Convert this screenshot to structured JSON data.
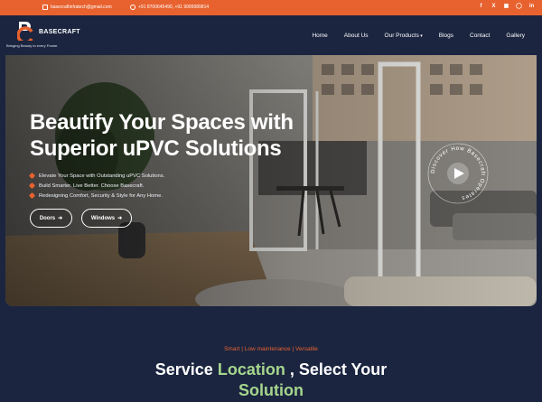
{
  "topbar": {
    "email": "basecraftinfratech@gmail.com",
    "phone": "+91 8700645490, +91 9999989814",
    "social_icons": [
      "facebook-icon",
      "x-icon",
      "instagram-icon",
      "whatsapp-icon",
      "linkedin-icon"
    ]
  },
  "brand": {
    "name": "BASECRAFT",
    "tagline": "Bringing Beauty to every Frame."
  },
  "nav": {
    "items": [
      "Home",
      "About Us",
      "Our Products",
      "Blogs",
      "Contact",
      "Gallery"
    ]
  },
  "hero": {
    "title_line1": "Beautify Your Spaces with",
    "title_line2": "Superior uPVC Solutions",
    "bullets": [
      "Elevate Your Space with Outstanding uPVC Solutions.",
      "Build Smarter. Live Better. Choose Basecraft.",
      "Redesigning Comfort, Security & Style for Any Home."
    ],
    "btn_doors": "Doors",
    "btn_windows": "Windows",
    "badge_text": "Discover How Basecraft Operates"
  },
  "section": {
    "kicker": "Smart | Low maintenance | Versatile",
    "title_a": "Service ",
    "title_b": "Location",
    "title_c": " , Select Your",
    "title_d": "Solution"
  },
  "colors": {
    "accent": "#e8622f",
    "navy": "#1b2540",
    "highlight": "#a6d68c"
  }
}
